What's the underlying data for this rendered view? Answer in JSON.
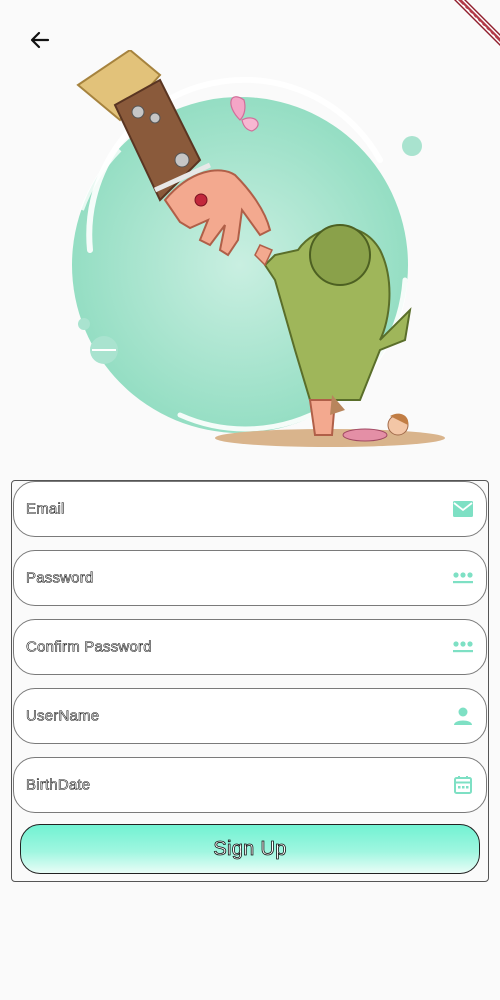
{
  "header": {
    "back_icon": "arrow-left-icon"
  },
  "debug_banner": {
    "icon": "debug-ribbon"
  },
  "form": {
    "fields": [
      {
        "label": "Email",
        "icon": "email-icon"
      },
      {
        "label": "Password",
        "icon": "password-dots-icon"
      },
      {
        "label": "Confirm Password",
        "icon": "password-dots-icon"
      },
      {
        "label": "UserName",
        "icon": "person-icon"
      },
      {
        "label": "BirthDate",
        "icon": "calendar-icon"
      }
    ],
    "submit_label": "Sign Up"
  },
  "colors": {
    "accent": "#7ee0c4",
    "button_top": "#72f2d2",
    "button_bottom": "#e9fdf7"
  }
}
